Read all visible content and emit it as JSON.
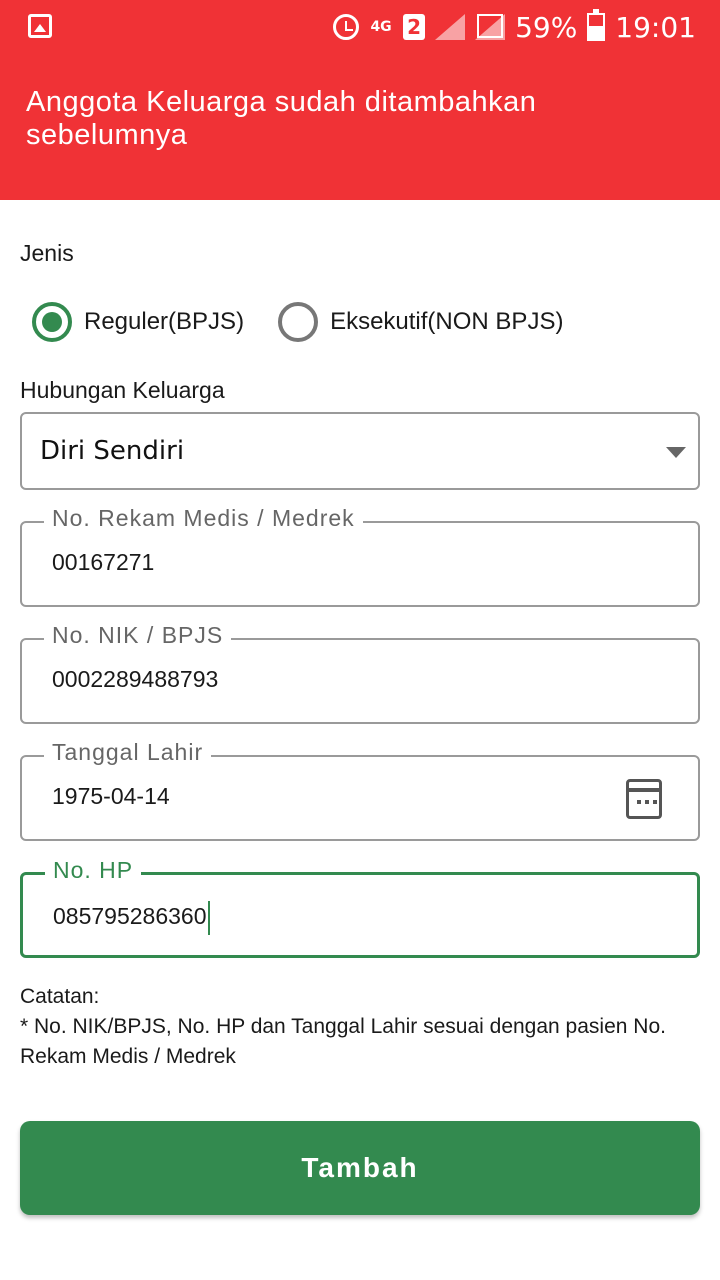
{
  "status_bar": {
    "network": "4G",
    "sim": "2",
    "battery": "59%",
    "time": "19:01"
  },
  "snackbar": {
    "message": "Anggota Keluarga sudah ditambahkan sebelumnya",
    "color": "#f03236"
  },
  "form": {
    "jenis_label": "Jenis",
    "radio": {
      "option_1": "Reguler(BPJS)",
      "option_2": "Eksekutif(NON BPJS)",
      "selected": "Reguler(BPJS)"
    },
    "hubungan_label": "Hubungan Keluarga",
    "hubungan_value": "Diri Sendiri",
    "fields": {
      "medrek": {
        "label": "No. Rekam Medis / Medrek",
        "value": "00167271"
      },
      "nik": {
        "label": "No. NIK / BPJS",
        "value": "0002289488793"
      },
      "tanggal": {
        "label": "Tanggal Lahir",
        "value": "1975-04-14"
      },
      "hp": {
        "label": "No. HP",
        "value": "085795286360"
      }
    },
    "note_title": "Catatan:",
    "note_text": "* No. NIK/BPJS, No. HP dan Tanggal Lahir sesuai dengan pasien No. Rekam Medis / Medrek",
    "submit_label": "Tambah"
  },
  "colors": {
    "accent": "#338a4f",
    "error": "#f03236"
  },
  "icons": [
    "gallery-icon",
    "alarm-icon",
    "signal-icon",
    "battery-icon",
    "calendar-icon",
    "dropdown-caret-icon"
  ]
}
